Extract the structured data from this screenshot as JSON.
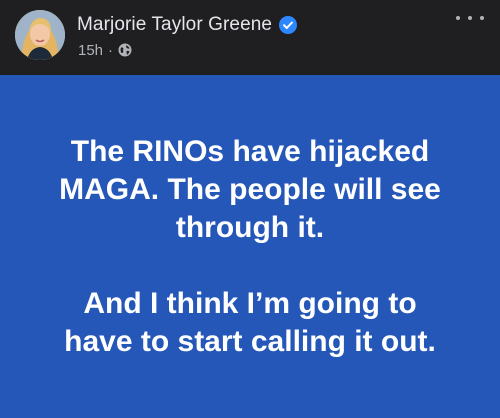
{
  "author": {
    "name": "Marjorie Taylor Greene",
    "verified_icon": "verified-badge-icon"
  },
  "meta": {
    "time": "15h",
    "separator": "·",
    "audience_icon": "globe-icon"
  },
  "menu": {
    "icon": "more-options-icon"
  },
  "post": {
    "background_color": "#2457b8",
    "lines_1": [
      "The RINOs have hijacked",
      "MAGA. The people will see",
      "through it."
    ],
    "lines_2": [
      "And I think I’m going to",
      "have to start calling it out."
    ]
  }
}
